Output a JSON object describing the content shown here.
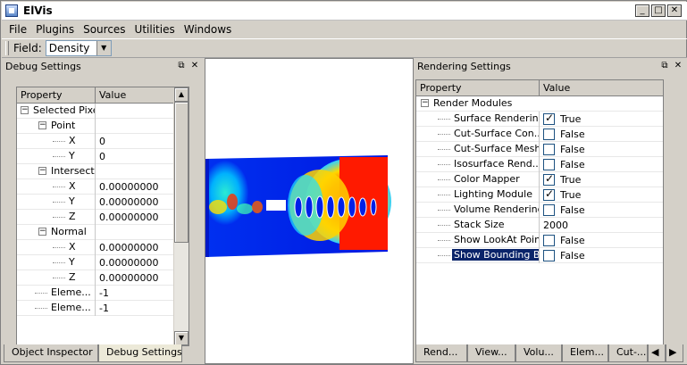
{
  "window": {
    "title": "ElVis",
    "buttons": {
      "minimize": "_",
      "maximize": "□",
      "close": "✕"
    }
  },
  "menu": [
    "File",
    "Plugins",
    "Sources",
    "Utilities",
    "Windows"
  ],
  "toolbar": {
    "field_label": "Field:",
    "field_value": "Density"
  },
  "debug_panel": {
    "title": "Debug Settings",
    "col_property": "Property",
    "col_value": "Value",
    "rows": [
      {
        "label": "Selected Pixel",
        "value": "",
        "depth": 0,
        "expander": "minus"
      },
      {
        "label": "Point",
        "value": "",
        "depth": 1,
        "expander": "minus"
      },
      {
        "label": "X",
        "value": "0",
        "depth": 2
      },
      {
        "label": "Y",
        "value": "0",
        "depth": 2
      },
      {
        "label": "Intersection Point",
        "value": "",
        "depth": 1,
        "expander": "minus"
      },
      {
        "label": "X",
        "value": "0.00000000",
        "depth": 2
      },
      {
        "label": "Y",
        "value": "0.00000000",
        "depth": 2
      },
      {
        "label": "Z",
        "value": "0.00000000",
        "depth": 2
      },
      {
        "label": "Normal",
        "value": "",
        "depth": 1,
        "expander": "minus"
      },
      {
        "label": "X",
        "value": "0.00000000",
        "depth": 2
      },
      {
        "label": "Y",
        "value": "0.00000000",
        "depth": 2
      },
      {
        "label": "Z",
        "value": "0.00000000",
        "depth": 2
      },
      {
        "label": "Eleme...",
        "value": "-1",
        "depth": 1
      },
      {
        "label": "Eleme...",
        "value": "-1",
        "depth": 1
      }
    ],
    "tabs": [
      "Object Inspector",
      "Debug Settings"
    ],
    "active_tab": "Debug Settings"
  },
  "render_panel": {
    "title": "Rendering Settings",
    "col_property": "Property",
    "col_value": "Value",
    "group": "Render Modules",
    "rows": [
      {
        "label": "Surface Rendering",
        "value": "True",
        "checkbox": true,
        "checked": true
      },
      {
        "label": "Cut-Surface Con...",
        "value": "False",
        "checkbox": true,
        "checked": false
      },
      {
        "label": "Cut-Surface Mesh",
        "value": "False",
        "checkbox": true,
        "checked": false
      },
      {
        "label": "Isosurface Rend...",
        "value": "False",
        "checkbox": true,
        "checked": false
      },
      {
        "label": "Color Mapper",
        "value": "True",
        "checkbox": true,
        "checked": true
      },
      {
        "label": "Lighting Module",
        "value": "True",
        "checkbox": true,
        "checked": true
      },
      {
        "label": "Volume Rendering",
        "value": "False",
        "checkbox": true,
        "checked": false
      },
      {
        "label": "Stack Size",
        "value": "2000",
        "checkbox": false,
        "checked": false
      },
      {
        "label": "Show LookAt Point",
        "value": "False",
        "checkbox": true,
        "checked": false
      },
      {
        "label": "Show Bounding B...",
        "value": "False",
        "checkbox": true,
        "checked": false,
        "selected": true
      }
    ],
    "tabs": [
      "Rend...",
      "View...",
      "Volu...",
      "Elem...",
      "Cut-..."
    ]
  },
  "colors": {
    "selection": "#0a246a",
    "field_blue": "#1030e0",
    "field_red": "#e81010"
  }
}
